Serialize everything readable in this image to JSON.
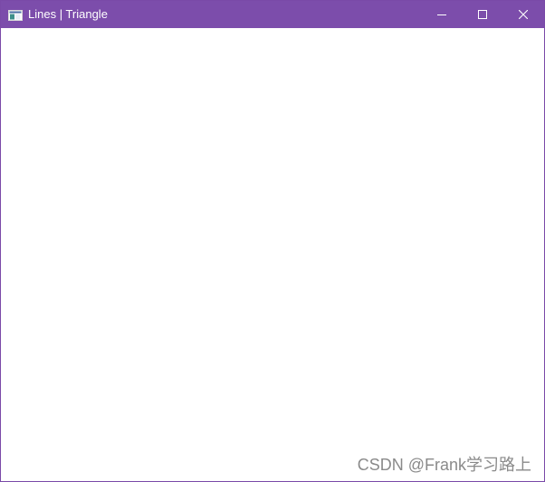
{
  "window": {
    "title": "Lines | Triangle",
    "titlebar_color": "#7c4dab",
    "border_color": "#7a4aa8",
    "background_color": "#ffffff",
    "icons": {
      "app": "app-window-icon",
      "minimize": "minimize-icon",
      "maximize": "maximize-icon",
      "close": "close-icon"
    }
  },
  "watermark": {
    "text": "CSDN @Frank学习路上"
  }
}
